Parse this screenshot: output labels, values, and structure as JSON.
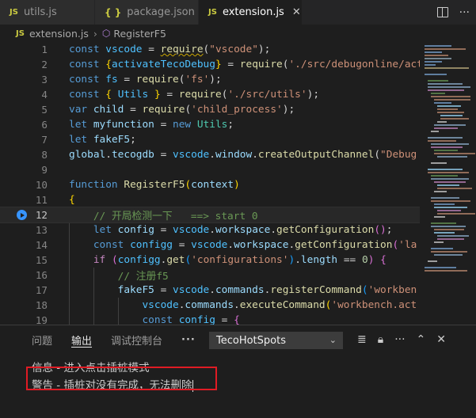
{
  "tabs": [
    {
      "icon": "JS",
      "label": "utils.js",
      "active": false
    },
    {
      "icon": "{ }",
      "label": "package.json",
      "active": false
    },
    {
      "icon": "JS",
      "label": "extension.js",
      "active": true,
      "close": "✕"
    }
  ],
  "breadcrumb": {
    "file_icon": "JS",
    "file": "extension.js",
    "separator": "›",
    "symbol": "RegisterF5"
  },
  "editor": {
    "line_numbers": [
      "1",
      "2",
      "3",
      "4",
      "5",
      "6",
      "7",
      "8",
      "9",
      "10",
      "11",
      "12",
      "13",
      "14",
      "15",
      "16",
      "17",
      "18",
      "19"
    ],
    "current_line": "12"
  },
  "panel": {
    "tabs": [
      "问题",
      "输出",
      "调试控制台",
      "···"
    ],
    "active_tab": "输出",
    "channel": "TecoHotSpots",
    "output_lines": [
      "信息 - 进入点击插桩模式",
      "警告 - 插桩对没有完成，无法删除"
    ]
  },
  "colors": {
    "accent": "#3794ff",
    "annotation": "#e01b24",
    "background": "#1e1e1e"
  }
}
